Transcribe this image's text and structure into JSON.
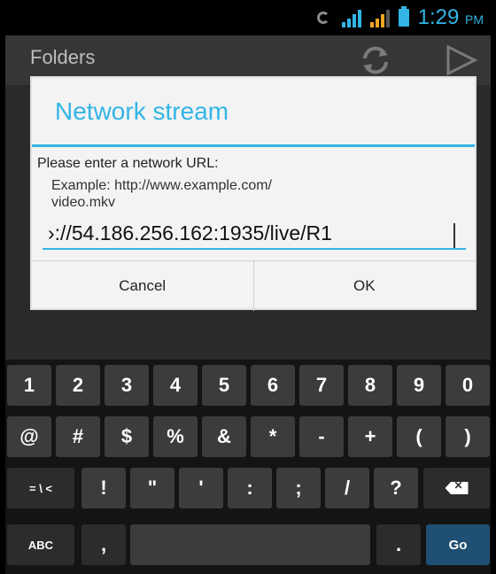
{
  "status_bar": {
    "time": "1:29",
    "ampm": "PM",
    "accent": "#33b5e5"
  },
  "action_bar": {
    "title": "Folders"
  },
  "dialog": {
    "title": "Network stream",
    "message": "Please enter a network URL:",
    "example_line1": "Example: http://www.example.com/",
    "example_line2": "video.mkv",
    "url_value": "›://54.186.256.162:1935/live/R1",
    "cancel_label": "Cancel",
    "ok_label": "OK"
  },
  "keyboard": {
    "row1": [
      "1",
      "2",
      "3",
      "4",
      "5",
      "6",
      "7",
      "8",
      "9",
      "0"
    ],
    "row2": [
      "@",
      "#",
      "$",
      "%",
      "&",
      "*",
      "-",
      "+",
      "(",
      ")"
    ],
    "row3_toggle": "= \\ <",
    "row3": [
      "!",
      "\"",
      "'",
      ":",
      ";",
      "/",
      "?"
    ],
    "row4_abc": "ABC",
    "row4_comma": ",",
    "row4_period": ".",
    "row4_go": "Go"
  }
}
